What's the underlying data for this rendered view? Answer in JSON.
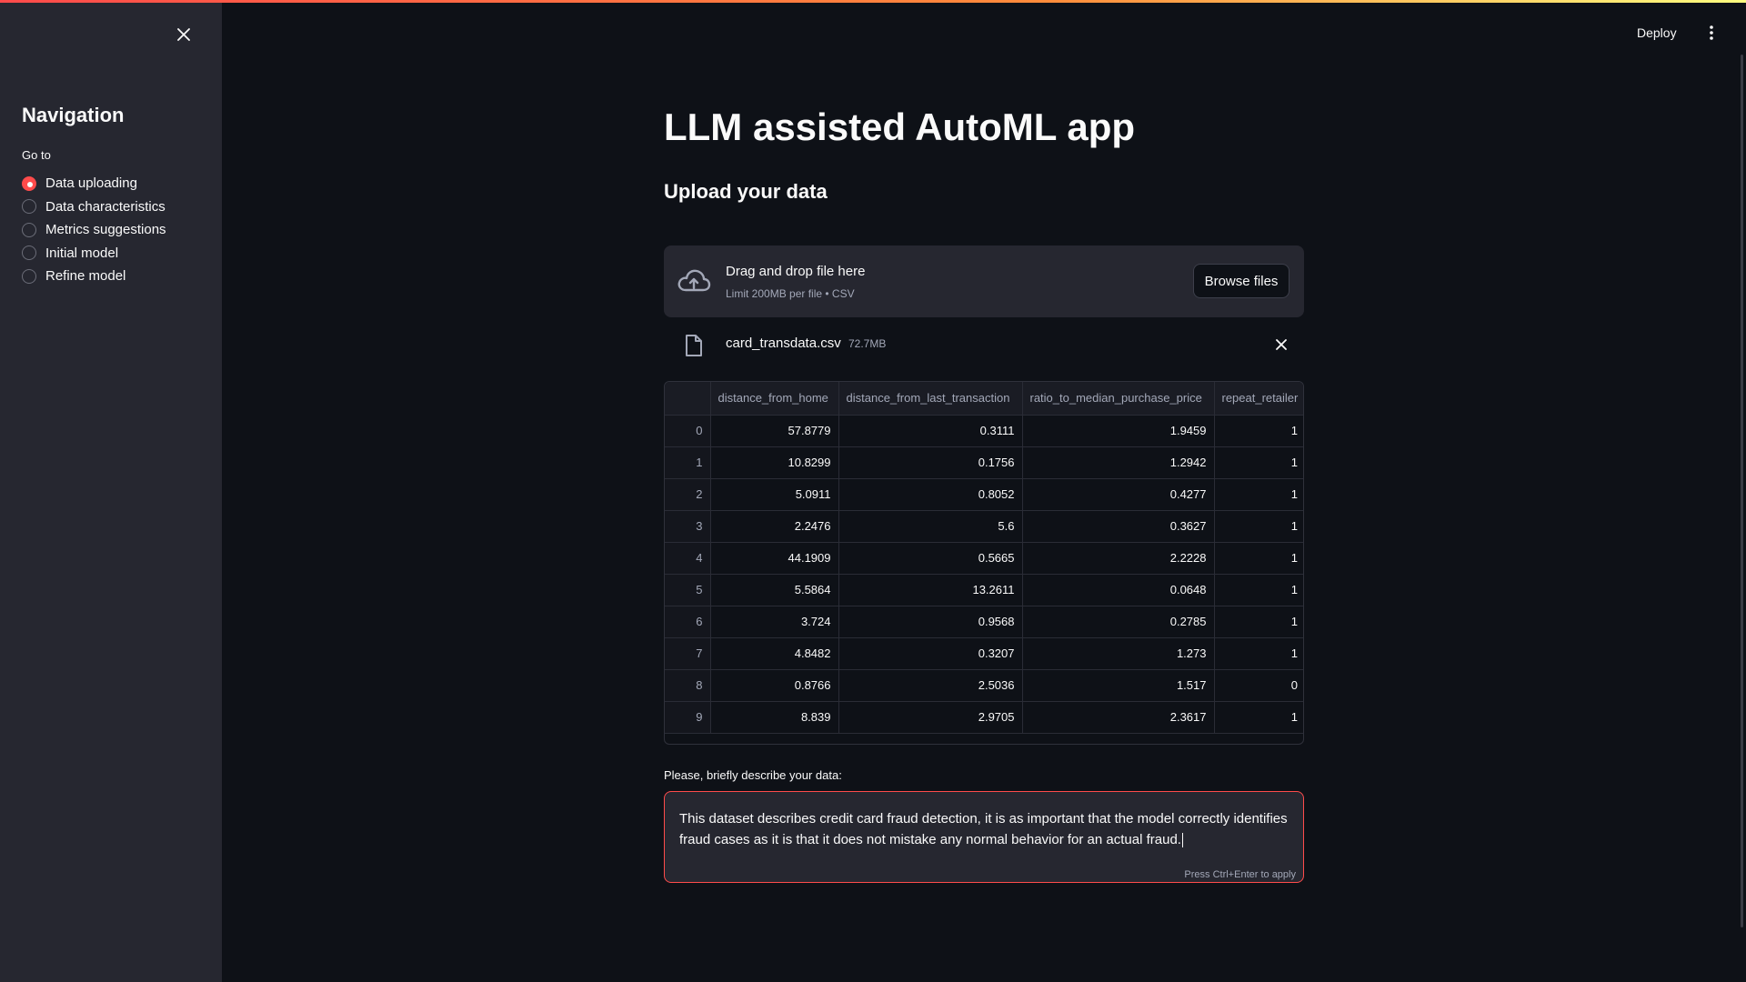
{
  "sidebar": {
    "title": "Navigation",
    "radio_label": "Go to",
    "options": [
      {
        "label": "Data uploading",
        "checked": true
      },
      {
        "label": "Data characteristics",
        "checked": false
      },
      {
        "label": "Metrics suggestions",
        "checked": false
      },
      {
        "label": "Initial model",
        "checked": false
      },
      {
        "label": "Refine model",
        "checked": false
      }
    ]
  },
  "header": {
    "deploy_label": "Deploy"
  },
  "main": {
    "title": "LLM assisted AutoML app",
    "subheader": "Upload your data",
    "uploader": {
      "title": "Drag and drop file here",
      "subtitle": "Limit 200MB per file • CSV",
      "browse_label": "Browse files"
    },
    "file": {
      "name": "card_transdata.csv",
      "size": "72.7MB"
    },
    "table": {
      "columns": [
        "",
        "distance_from_home",
        "distance_from_last_transaction",
        "ratio_to_median_purchase_price",
        "repeat_retailer"
      ],
      "rows": [
        [
          "0",
          "57.8779",
          "0.3111",
          "1.9459",
          "1"
        ],
        [
          "1",
          "10.8299",
          "0.1756",
          "1.2942",
          "1"
        ],
        [
          "2",
          "5.0911",
          "0.8052",
          "0.4277",
          "1"
        ],
        [
          "3",
          "2.2476",
          "5.6",
          "0.3627",
          "1"
        ],
        [
          "4",
          "44.1909",
          "0.5665",
          "2.2228",
          "1"
        ],
        [
          "5",
          "5.5864",
          "13.2611",
          "0.0648",
          "1"
        ],
        [
          "6",
          "3.724",
          "0.9568",
          "0.2785",
          "1"
        ],
        [
          "7",
          "4.8482",
          "0.3207",
          "1.273",
          "1"
        ],
        [
          "8",
          "0.8766",
          "2.5036",
          "1.517",
          "0"
        ],
        [
          "9",
          "8.839",
          "2.9705",
          "2.3617",
          "1"
        ]
      ]
    },
    "description": {
      "label": "Please, briefly describe your data:",
      "value": "This dataset describes credit card fraud detection, it is as important that the model correctly identifies fraud cases as it is that it does not mistake any normal behavior for an actual fraud.",
      "hint": "Press Ctrl+Enter to apply"
    }
  },
  "colors": {
    "accent": "#ff4b4b",
    "background": "#0e1117",
    "sidebar": "#262730"
  },
  "icons": {
    "sidebar_close": "close-icon",
    "more": "more-vertical-icon",
    "upload": "cloud-upload-icon",
    "file": "file-icon",
    "file_remove": "close-icon"
  }
}
